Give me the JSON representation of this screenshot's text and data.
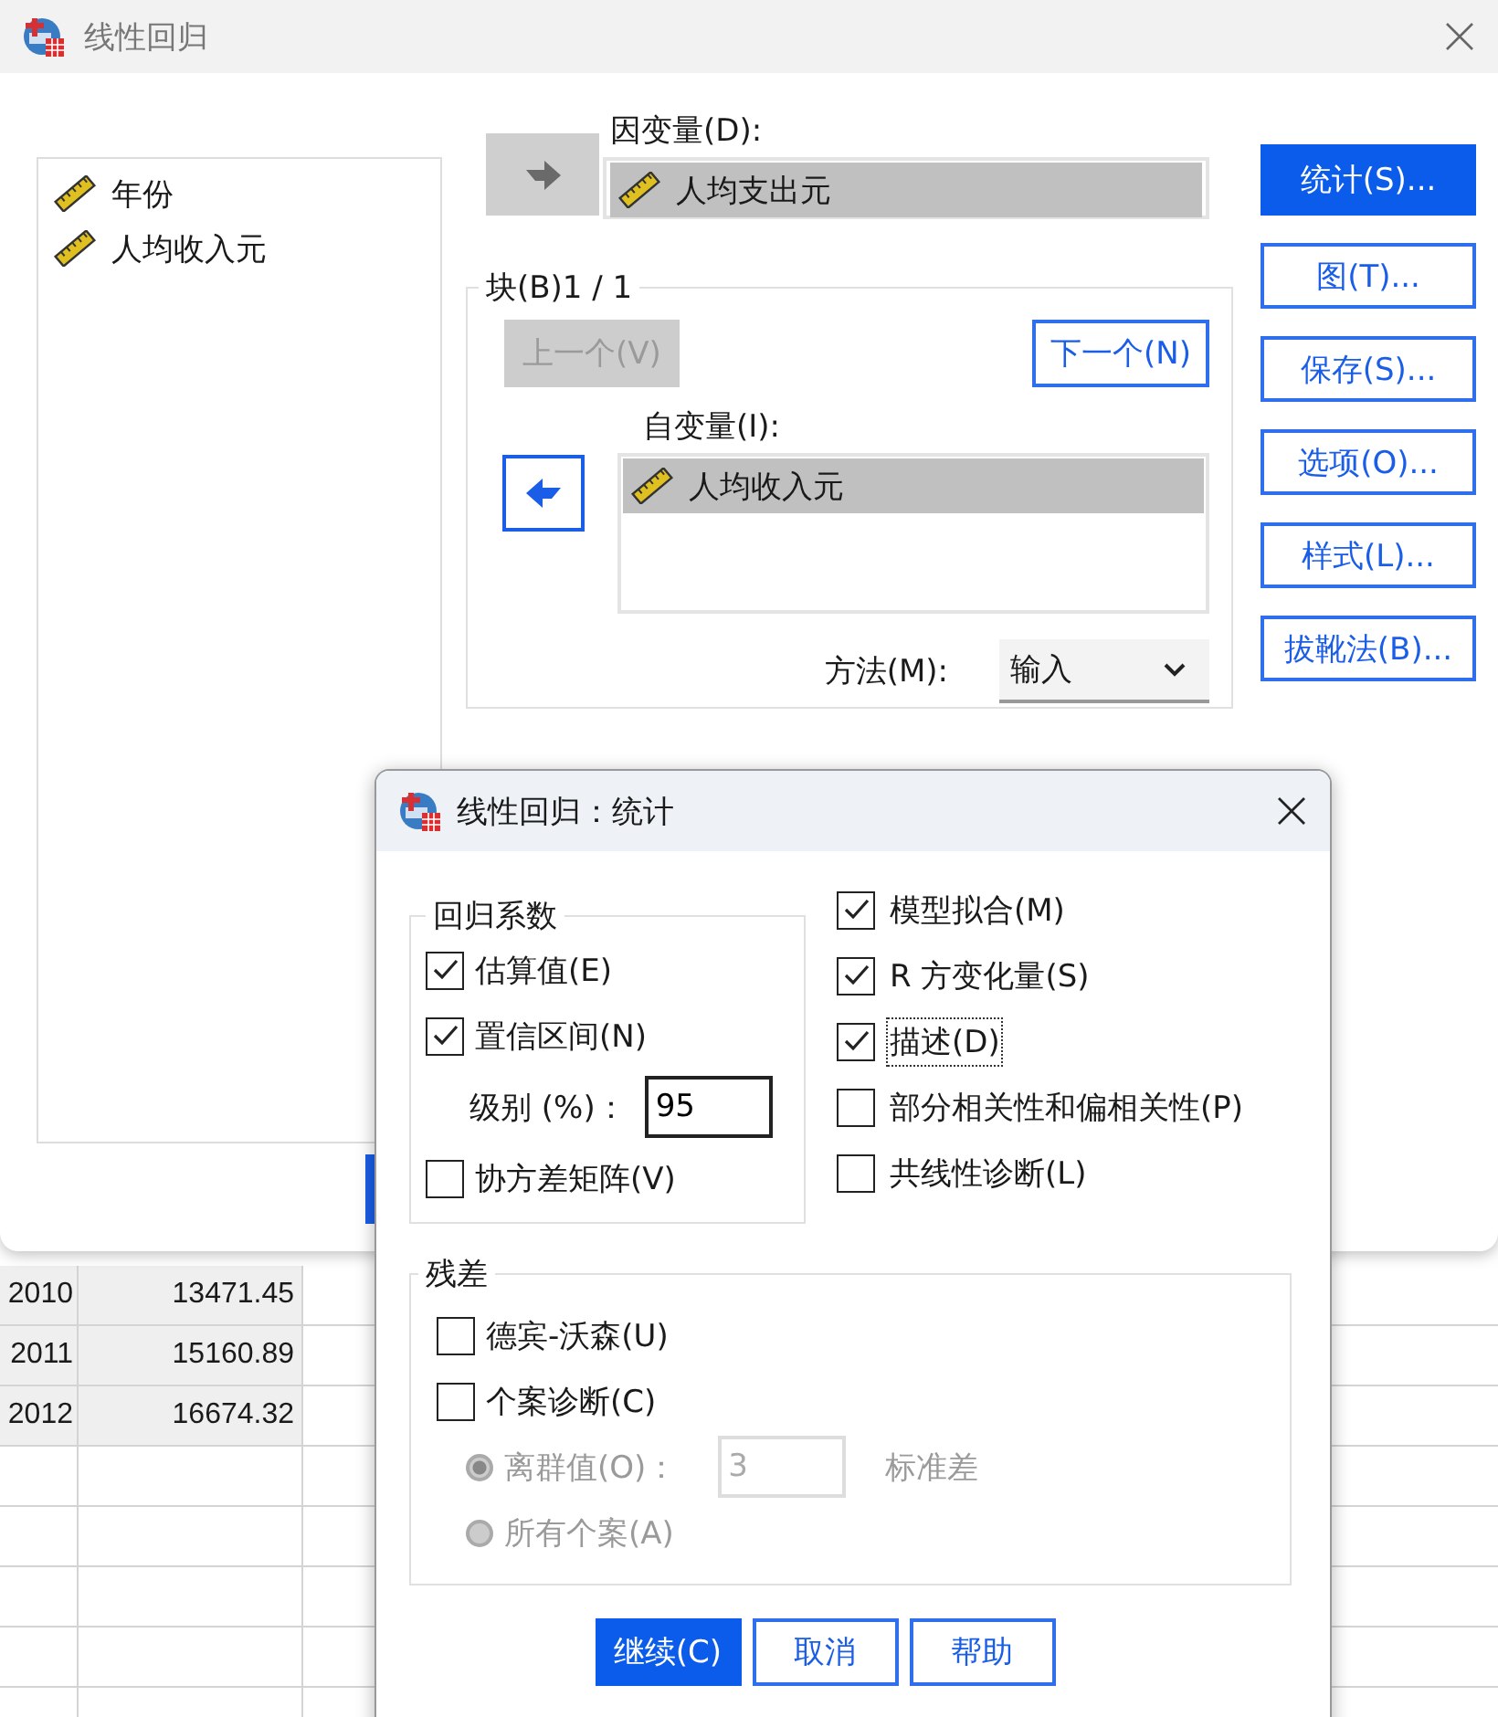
{
  "main_window": {
    "title": "线性回归",
    "variables": [
      {
        "name": "年份",
        "selected": false
      },
      {
        "name": "人均收入元",
        "selected": false
      }
    ],
    "dependent": {
      "label": "因变量(D):",
      "variables": [
        {
          "name": "人均支出元",
          "selected": true
        }
      ]
    },
    "block": {
      "label": "块(B)1 / 1",
      "previous": {
        "label": "上一个(V)",
        "disabled": true
      },
      "next": {
        "label": "下一个(N)",
        "disabled": false
      }
    },
    "independent": {
      "label": "自变量(I):",
      "variables": [
        {
          "name": "人均收入元",
          "selected": true
        }
      ]
    },
    "method": {
      "label": "方法(M):",
      "value": "输入"
    },
    "buttons": [
      {
        "label": "统计(S)...",
        "selected": true
      },
      {
        "label": "图(T)...",
        "selected": false
      },
      {
        "label": "保存(S)...",
        "selected": false
      },
      {
        "label": "选项(O)...",
        "selected": false
      },
      {
        "label": "样式(L)...",
        "selected": false
      },
      {
        "label": "拔靴法(B)...",
        "selected": false
      }
    ]
  },
  "data_grid": {
    "rows": [
      [
        "2010",
        "13471.45"
      ],
      [
        "2011",
        "15160.89"
      ],
      [
        "2012",
        "16674.32"
      ]
    ]
  },
  "stats_dialog": {
    "title": "线性回归：统计",
    "regression_coefficients": {
      "title": "回归系数",
      "options": [
        {
          "kind": "checkbox",
          "label": "估算值(E)",
          "checked": true
        },
        {
          "kind": "checkbox",
          "label": "置信区间(N)",
          "checked": true
        },
        {
          "kind": "field",
          "label": "级别 (%)：",
          "value": "95"
        },
        {
          "kind": "checkbox",
          "label": "协方差矩阵(V)",
          "checked": false
        }
      ]
    },
    "options": [
      {
        "label": "模型拟合(M)",
        "checked": true,
        "focused": false
      },
      {
        "label": "R 方变化量(S)",
        "checked": true,
        "focused": false
      },
      {
        "label": "描述(D)",
        "checked": true,
        "focused": true
      },
      {
        "label": "部分相关性和偏相关性(P)",
        "checked": false,
        "focused": false
      },
      {
        "label": "共线性诊断(L)",
        "checked": false,
        "focused": false
      }
    ],
    "residuals": {
      "title": "残差",
      "options": [
        {
          "kind": "checkbox",
          "label": "德宾-沃森(U)",
          "checked": false
        },
        {
          "kind": "checkbox",
          "label": "个案诊断(C)",
          "checked": false
        },
        {
          "kind": "radio",
          "label": "离群值(O)：",
          "selected": true,
          "disabled": true,
          "value": "3",
          "unit": "标准差"
        },
        {
          "kind": "radio",
          "label": "所有个案(A)",
          "selected": false,
          "disabled": true
        }
      ]
    },
    "buttons": [
      {
        "label": "继续(C)",
        "selected": true
      },
      {
        "label": "取消",
        "selected": false
      },
      {
        "label": "帮助",
        "selected": false
      }
    ]
  }
}
